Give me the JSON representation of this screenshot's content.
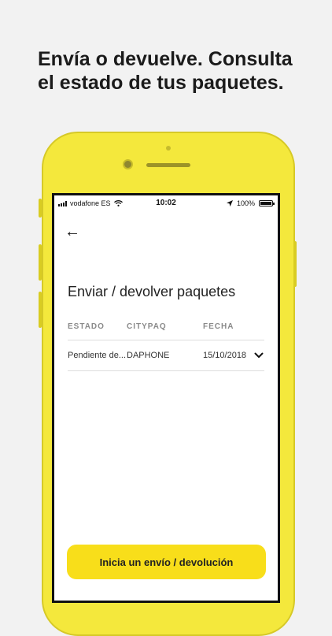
{
  "headline": {
    "line1": "Envía o devuelve. Consulta",
    "line2": "el estado de tus paquetes."
  },
  "status_bar": {
    "carrier": "vodafone ES",
    "time": "10:02",
    "battery": "100%"
  },
  "screen": {
    "title": "Enviar / devolver paquetes",
    "table": {
      "headers": [
        "ESTADO",
        "CITYPAQ",
        "FECHA"
      ],
      "rows": [
        {
          "estado": "Pendiente de...",
          "citypaq": "DAPHONE",
          "fecha": "15/10/2018"
        }
      ]
    },
    "cta_label": "Inicia un envío / devolución"
  },
  "icons": {
    "back": "arrow-left-icon",
    "expand": "chevron-down-icon",
    "wifi": "wifi-icon",
    "location": "location-arrow-icon",
    "signal": "signal-bars-icon",
    "battery": "battery-icon"
  },
  "colors": {
    "phone_body": "#f4e83c",
    "accent_button": "#f8de1a",
    "background": "#f2f2f2"
  }
}
